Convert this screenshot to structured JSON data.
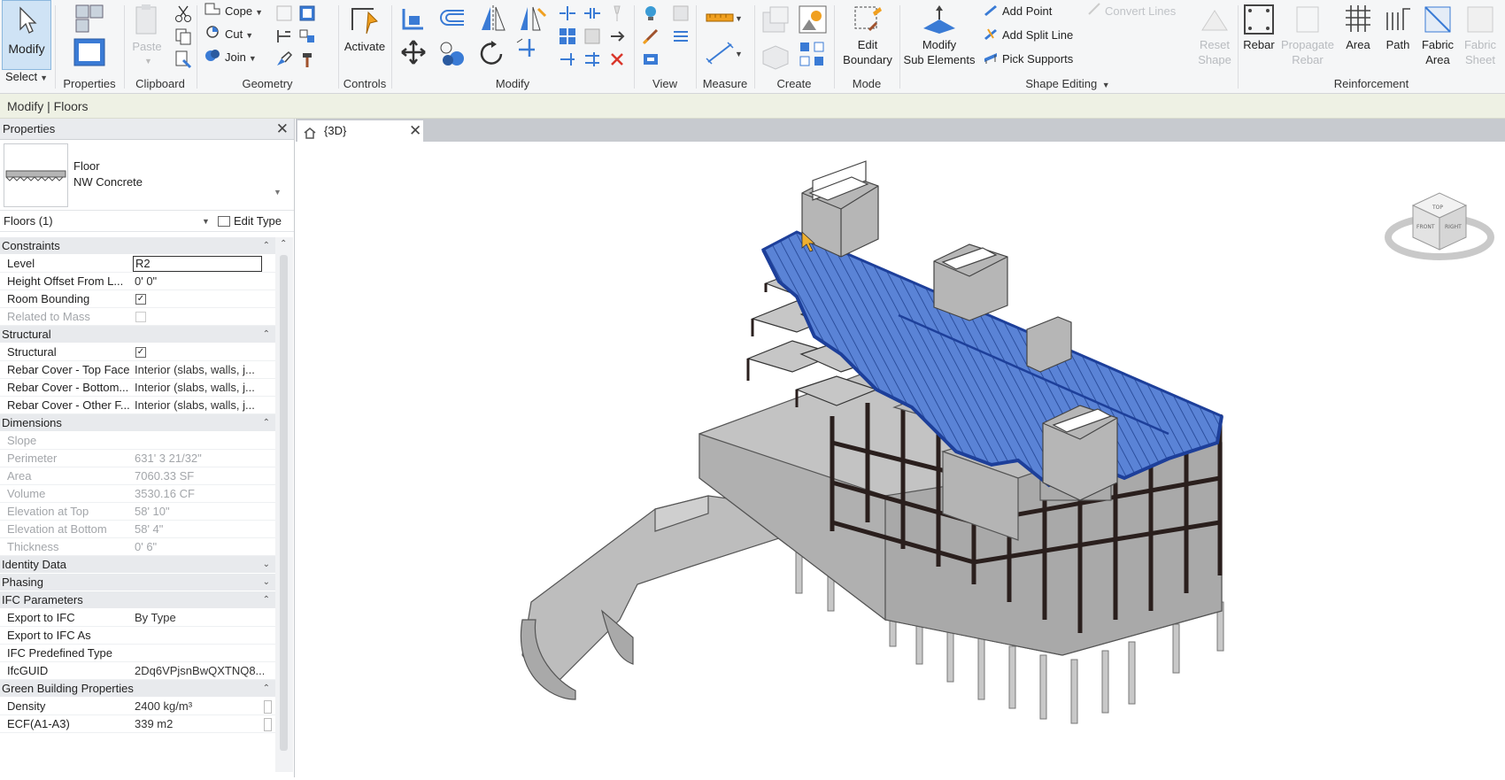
{
  "ribbon": {
    "modify_label": "Modify",
    "select_label": "Select",
    "properties_label": "Properties",
    "clipboard": {
      "title": "Clipboard",
      "paste_label": "Paste"
    },
    "geometry": {
      "title": "Geometry",
      "cope_label": "Cope",
      "cut_label": "Cut",
      "join_label": "Join"
    },
    "controls": {
      "title": "Controls",
      "activate_label": "Activate"
    },
    "modify_panel": {
      "title": "Modify"
    },
    "view_panel": {
      "title": "View"
    },
    "measure_panel": {
      "title": "Measure"
    },
    "create_panel": {
      "title": "Create"
    },
    "mode": {
      "title": "Mode",
      "edit_label_1": "Edit",
      "edit_label_2": "Boundary"
    },
    "shape_editing": {
      "title": "Shape Editing",
      "modify_sub_1": "Modify",
      "modify_sub_2": "Sub Elements",
      "add_point": "Add Point",
      "add_split_line": "Add Split Line",
      "pick_supports": "Pick Supports",
      "convert_lines": "Convert Lines",
      "reset_shape_1": "Reset",
      "reset_shape_2": "Shape"
    },
    "reinforcement": {
      "title": "Reinforcement",
      "rebar": "Rebar",
      "propagate_1": "Propagate",
      "propagate_2": "Rebar",
      "area": "Area",
      "path": "Path",
      "fabric_area_1": "Fabric",
      "fabric_area_2": "Area",
      "fabric_sheet_1": "Fabric",
      "fabric_sheet_2": "Sheet"
    }
  },
  "optionbar": {
    "context": "Modify | Floors"
  },
  "properties": {
    "title": "Properties",
    "type_family": "Floor",
    "type_name": "NW Concrete",
    "instance_label": "Floors (1)",
    "edit_type_label": "Edit Type",
    "groups": {
      "constraints": "Constraints",
      "structural": "Structural",
      "dimensions": "Dimensions",
      "identity": "Identity Data",
      "phasing": "Phasing",
      "ifc": "IFC Parameters",
      "green": "Green Building Properties"
    },
    "rows": {
      "level_k": "Level",
      "level_v": "R2",
      "height_k": "Height Offset From L...",
      "height_v": "0'  0\"",
      "room_k": "Room Bounding",
      "mass_k": "Related to Mass",
      "structural_k": "Structural",
      "rc_top_k": "Rebar Cover - Top Face",
      "rc_top_v": "Interior (slabs, walls, j...",
      "rc_bot_k": "Rebar Cover - Bottom...",
      "rc_bot_v": "Interior (slabs, walls, j...",
      "rc_oth_k": "Rebar Cover - Other F...",
      "rc_oth_v": "Interior (slabs, walls, j...",
      "slope_k": "Slope",
      "perimeter_k": "Perimeter",
      "perimeter_v": "631'  3 21/32\"",
      "area_k": "Area",
      "area_v": "7060.33 SF",
      "volume_k": "Volume",
      "volume_v": "3530.16 CF",
      "elev_top_k": "Elevation at Top",
      "elev_top_v": "58'  10\"",
      "elev_bot_k": "Elevation at Bottom",
      "elev_bot_v": "58'  4\"",
      "thick_k": "Thickness",
      "thick_v": "0'  6\"",
      "export_k": "Export to IFC",
      "export_v": "By Type",
      "export_as_k": "Export to IFC As",
      "predef_k": "IFC Predefined Type",
      "guid_k": "IfcGUID",
      "guid_v": "2Dq6VPjsnBwQXTNQ8...",
      "density_k": "Density",
      "density_v": "2400 kg/m³",
      "ecf_k": "ECF(A1-A3)",
      "ecf_v": "339 m2"
    }
  },
  "view": {
    "tab_label": "{3D}"
  },
  "viewcube": {
    "top": "TOP",
    "front": "FRONT",
    "right": "RIGHT"
  },
  "colors": {
    "selection": "#2f5fc8",
    "concrete": "#b5b5b5",
    "steel": "#2a1f1d"
  }
}
